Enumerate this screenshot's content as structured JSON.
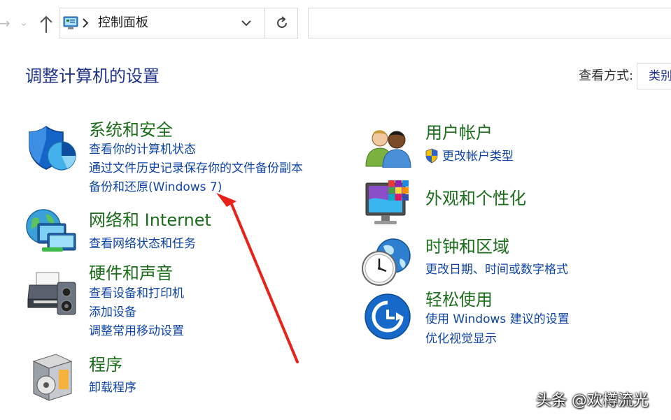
{
  "toolbar": {
    "forward_icon": "forward-arrow-icon",
    "history_icon": "chevron-down-icon",
    "up_icon": "up-arrow-icon",
    "refresh_icon": "refresh-icon"
  },
  "address": {
    "current": "控制面板"
  },
  "header": {
    "title": "调整计算机的设置",
    "view_by_label": "查看方式:",
    "view_by_value": "类别"
  },
  "categories": {
    "system": {
      "title": "系统和安全",
      "icon": "security-shield-icon",
      "links": [
        "查看你的计算机状态",
        "通过文件历史记录保存你的文件备份副本",
        "备份和还原(Windows 7)"
      ]
    },
    "network": {
      "title": "网络和 Internet",
      "icon": "network-globe-icon",
      "links": [
        "查看网络状态和任务"
      ]
    },
    "hardware": {
      "title": "硬件和声音",
      "icon": "printer-speaker-icon",
      "links": [
        "查看设备和打印机",
        "添加设备",
        "调整常用移动设置"
      ]
    },
    "programs": {
      "title": "程序",
      "icon": "programs-box-icon",
      "links": [
        "卸载程序"
      ]
    },
    "users": {
      "title": "用户帐户",
      "icon": "users-icon",
      "links": [
        "更改帐户类型"
      ]
    },
    "appearance": {
      "title": "外观和个性化",
      "icon": "appearance-monitor-icon",
      "links": []
    },
    "clock": {
      "title": "时钟和区域",
      "icon": "clock-globe-icon",
      "links": [
        "更改日期、时间或数字格式"
      ]
    },
    "ease": {
      "title": "轻松使用",
      "icon": "ease-of-access-icon",
      "links": [
        "使用 Windows 建议的设置",
        "优化视觉显示"
      ]
    }
  },
  "colors": {
    "title_blue": "#1e3287",
    "category_green": "#1b6d1b",
    "link_blue": "#0f44a7",
    "annotation_red": "#e8221a"
  },
  "watermark": "头条 @欢樽流光"
}
